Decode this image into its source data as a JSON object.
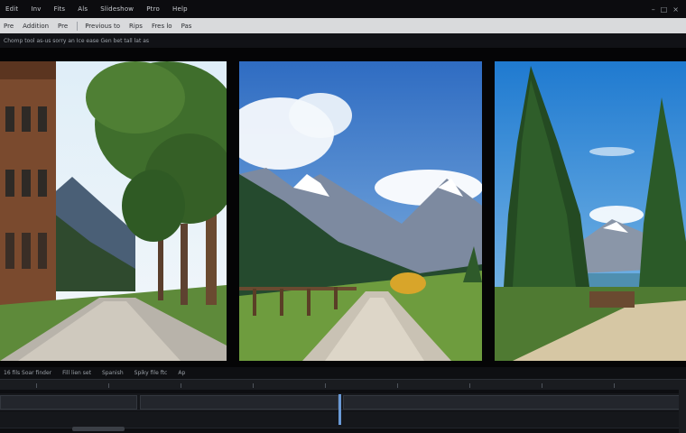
{
  "menubar": {
    "items": [
      "Edit",
      "Inv",
      "Fits",
      "Als",
      "Slideshow",
      "Ptro",
      "Help"
    ],
    "window": {
      "min": "–",
      "max": "□",
      "close": "×"
    }
  },
  "toolbar": {
    "items": [
      "Pre",
      "Addition",
      "Pre",
      "Previous to",
      "Rips",
      "Fres lo",
      "Pas"
    ]
  },
  "pathbar": {
    "text": "Chomp tool as-us sorry an Ice ease Gen bet tall lat as"
  },
  "infobar": {
    "items": [
      "16 fils Soar finder",
      "Fill lien set",
      "Spanish",
      "Spiky file ftc",
      "Ap"
    ]
  },
  "colors": {
    "accent": "#6a9ad6",
    "menubar_bg": "#0c0c0f",
    "toolbar_bg": "#d9dadc",
    "viewer_bg": "#050506"
  }
}
